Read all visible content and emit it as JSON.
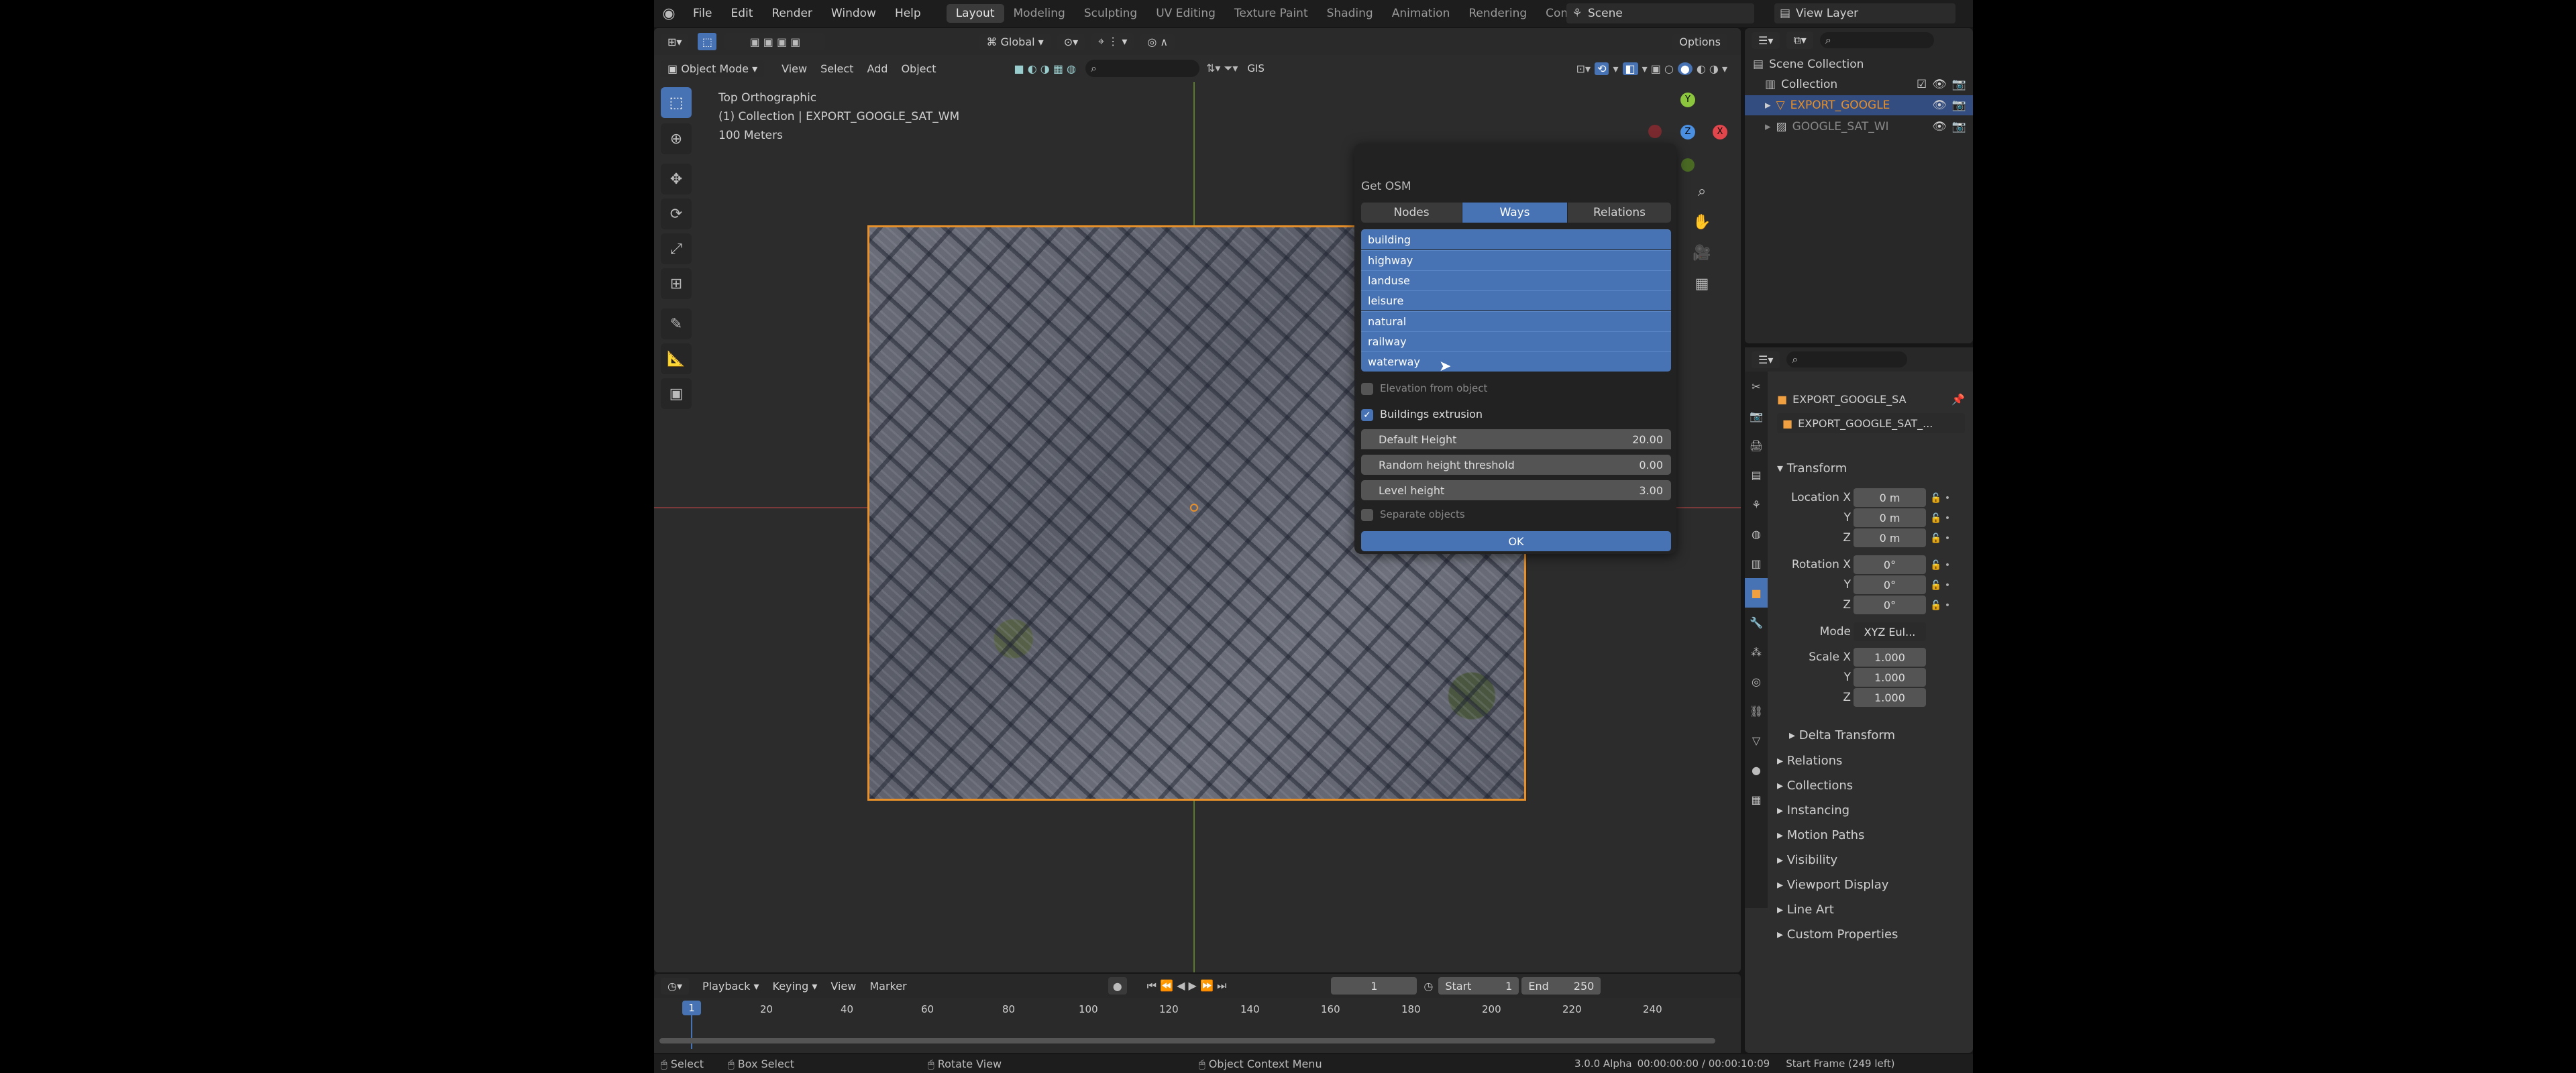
{
  "topbar": {
    "menus": [
      "File",
      "Edit",
      "Render",
      "Window",
      "Help"
    ],
    "workspaces": [
      "Layout",
      "Modeling",
      "Sculpting",
      "UV Editing",
      "Texture Paint",
      "Shading",
      "Animation",
      "Rendering",
      "Compo"
    ],
    "scene": "Scene",
    "view_layer": "View Layer"
  },
  "viewport": {
    "orientation_label": "Global",
    "options_label": "Options",
    "mode": "Object Mode",
    "menus": [
      "View",
      "Select",
      "Add",
      "Object"
    ],
    "gis_label": "GIS",
    "overlay_view": "Top Orthographic",
    "overlay_collection": "(1) Collection | EXPORT_GOOGLE_SAT_WM",
    "overlay_scale": "100 Meters"
  },
  "dialog": {
    "title": "Get OSM",
    "tabs": [
      "Nodes",
      "Ways",
      "Relations"
    ],
    "active_tab": "Ways",
    "items": [
      "building",
      "highway",
      "landuse",
      "leisure",
      "natural",
      "railway",
      "waterway"
    ],
    "elevation_label": "Elevation from object",
    "buildings_label": "Buildings extrusion",
    "default_height_label": "Default Height",
    "default_height_value": "20.00",
    "random_height_label": "Random height threshold",
    "random_height_value": "0.00",
    "level_height_label": "Level height",
    "level_height_value": "3.00",
    "separate_label": "Separate objects",
    "ok_label": "OK"
  },
  "outliner": {
    "scene_collection": "Scene Collection",
    "collection": "Collection",
    "items": [
      "EXPORT_GOOGLE",
      "GOOGLE_SAT_WI"
    ]
  },
  "properties": {
    "object_name": "EXPORT_GOOGLE_SA",
    "data_name": "EXPORT_GOOGLE_SAT_...",
    "transform_label": "Transform",
    "location_label": "Location X",
    "rotation_label": "Rotation X",
    "scale_label": "Scale X",
    "y_label": "Y",
    "z_label": "Z",
    "mode_label": "Mode",
    "location": [
      "0 m",
      "0 m",
      "0 m"
    ],
    "rotation": [
      "0°",
      "0°",
      "0°"
    ],
    "mode_value": "XYZ Eul...",
    "scale": [
      "1.000",
      "1.000",
      "1.000"
    ],
    "delta": "Delta Transform",
    "panels": [
      "Relations",
      "Collections",
      "Instancing",
      "Motion Paths",
      "Visibility",
      "Viewport Display",
      "Line Art",
      "Custom Properties"
    ]
  },
  "timeline": {
    "menus": [
      "Playback",
      "Keying",
      "View",
      "Marker"
    ],
    "current_frame": "1",
    "start_label": "Start",
    "start_value": "1",
    "end_label": "End",
    "end_value": "250",
    "ticks": [
      "1",
      "20",
      "40",
      "60",
      "80",
      "100",
      "120",
      "140",
      "160",
      "180",
      "200",
      "220",
      "240"
    ]
  },
  "statusbar": {
    "select": "Select",
    "box_select": "Box Select",
    "rotate_view": "Rotate View",
    "context_menu": "Object Context Menu",
    "version": "3.0.0 Alpha",
    "time": "00:00:00:00 / 00:00:10:09",
    "frame_info": "Start Frame (249 left)"
  }
}
